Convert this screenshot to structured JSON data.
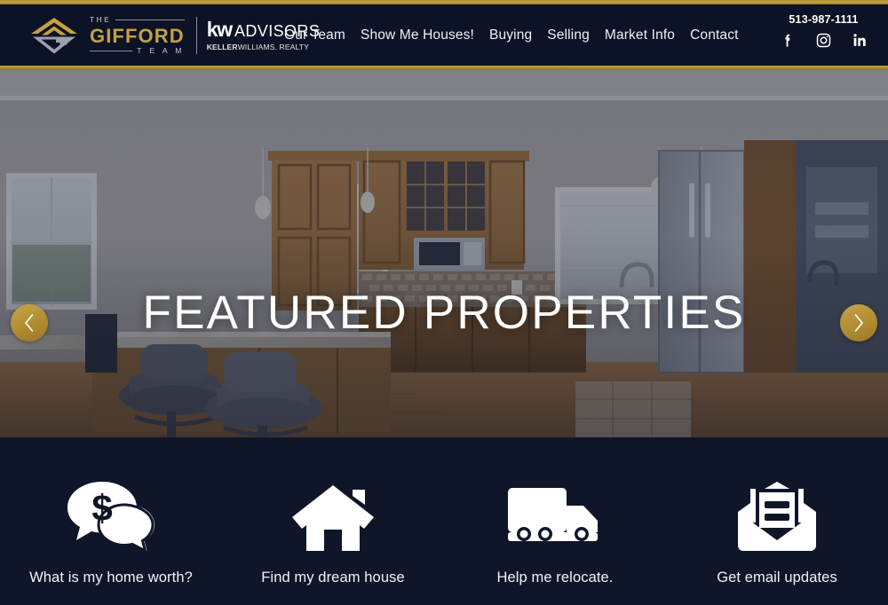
{
  "brand": {
    "logo_the": "THE",
    "logo_name": "GIFFORD",
    "logo_team": "T E A M",
    "kw_mark": "kw",
    "kw_advisors": "ADVISORS",
    "kw_sub_bold": "KELLER",
    "kw_sub_rest": "WILLIAMS. REALTY",
    "gold": "#c6a143",
    "header_bg": "#0d1326"
  },
  "nav": {
    "items": [
      {
        "label": "Our Team"
      },
      {
        "label": "Show Me Houses!"
      },
      {
        "label": "Buying"
      },
      {
        "label": "Selling"
      },
      {
        "label": "Market Info"
      },
      {
        "label": "Contact"
      }
    ]
  },
  "contact": {
    "phone": "513-987-1111",
    "socials": [
      {
        "name": "facebook-icon"
      },
      {
        "name": "instagram-icon"
      },
      {
        "name": "linkedin-icon"
      }
    ]
  },
  "hero": {
    "title": "FEATURED PROPERTIES",
    "prev_label": "Previous slide",
    "next_label": "Next slide",
    "image_description": "Kitchen interior with wooden cabinets, granite island and bar stools"
  },
  "features": [
    {
      "icon": "chat-dollar-icon",
      "label": "What is my home worth?"
    },
    {
      "icon": "house-icon",
      "label": "Find my dream house"
    },
    {
      "icon": "moving-truck-icon",
      "label": "Help me relocate."
    },
    {
      "icon": "open-envelope-icon",
      "label": "Get email updates"
    }
  ]
}
